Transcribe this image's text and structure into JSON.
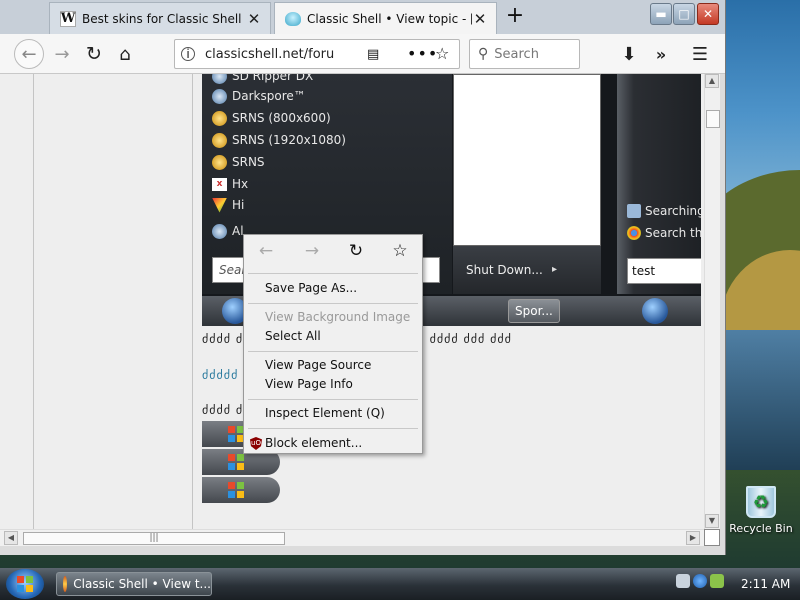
{
  "desktop": {
    "recycle_bin_label": "Recycle Bin"
  },
  "browser": {
    "tabs": [
      {
        "title": "Best skins for Classic Shell",
        "favicon": "W",
        "close": "✕"
      },
      {
        "title": "Classic Shell • View topic - [Skin",
        "close": "✕"
      }
    ],
    "new_tab": "+",
    "window_buttons": {
      "minimize": "▬",
      "maximize": "□",
      "close": "✕"
    },
    "url": "classicshell.net/foru",
    "search_placeholder": "Search",
    "icons": {
      "back": "←",
      "forward": "→",
      "reload": "↻",
      "home": "⌂",
      "downloads": "⬇",
      "overflow": "»",
      "menu": "☰",
      "page_actions": "•••",
      "bookmark": "☆",
      "reader": "▤",
      "info": "i",
      "search": "⚲"
    }
  },
  "screenshot": {
    "start_items": [
      "SD Ripper DX",
      "Darkspore™",
      "SRNS (800x600)",
      "SRNS (1920x1080)",
      "SRNS",
      "Hx",
      "Hi",
      "Al"
    ],
    "search_placeholder": "Sear",
    "shut_down": "Shut Down...",
    "shut_down_arrow": "▸",
    "right_items": [
      "Searching...",
      "Search the"
    ],
    "right_search_value": "test",
    "taskbar_button": "Spor..."
  },
  "page": {
    "line1": "ძძძძ ძძძძძძძძ ძძძძძძ ძძძძ ძძძძძძ ძძძძ ძძძ ძძძ",
    "link_line": "ძძძძძ",
    "line3": "ძძძძ ძძძძძძძძ ძძძძძ ძძძძძძ"
  },
  "context_menu": {
    "nav": {
      "back": "←",
      "forward": "→",
      "reload": "↻",
      "bookmark": "☆"
    },
    "items": [
      {
        "label": "Save Page As...",
        "disabled": false
      },
      {
        "label": "View Background Image",
        "disabled": true
      },
      {
        "label": "Select All",
        "disabled": false
      },
      {
        "label": "View Page Source",
        "disabled": false
      },
      {
        "label": "View Page Info",
        "disabled": false
      },
      {
        "label": "Inspect Element (Q)",
        "disabled": false
      },
      {
        "label": "Block element...",
        "disabled": false
      }
    ],
    "ublock_badge": "uO"
  },
  "scrollbars": {
    "up": "▲",
    "down": "▼",
    "left": "◀",
    "right": "▶",
    "grip": "|||"
  },
  "taskbar": {
    "window_title": "Classic Shell • View t...",
    "clock": "2:11 AM"
  }
}
